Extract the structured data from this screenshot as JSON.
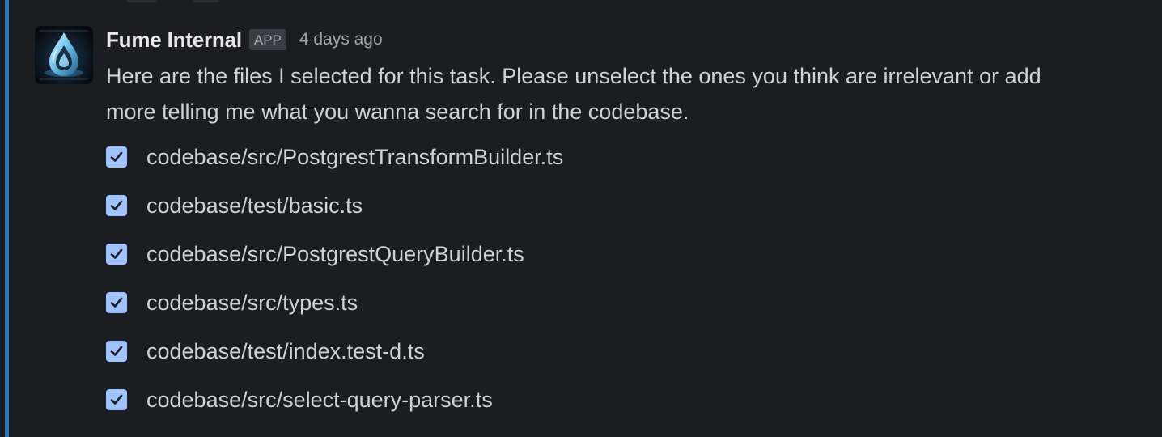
{
  "message": {
    "sender": "Fume Internal",
    "badge": "APP",
    "timestamp": "4 days ago",
    "body": "Here are the files I selected for this task. Please unselect the ones you think are irrelevant or add more telling me what you wanna search for in the codebase."
  },
  "files": [
    {
      "path": "codebase/src/PostgrestTransformBuilder.ts",
      "checked": true
    },
    {
      "path": "codebase/test/basic.ts",
      "checked": true
    },
    {
      "path": "codebase/src/PostgrestQueryBuilder.ts",
      "checked": true
    },
    {
      "path": "codebase/src/types.ts",
      "checked": true
    },
    {
      "path": "codebase/test/index.test-d.ts",
      "checked": true
    },
    {
      "path": "codebase/src/select-query-parser.ts",
      "checked": true
    }
  ],
  "colors": {
    "background": "#1b1d21",
    "thread_accent": "#2f74b5",
    "checkbox": "#9fc3ff",
    "checkmark": "#1b1d21"
  },
  "icons": {
    "avatar": "water-drop-logo-icon",
    "checkbox": "check-icon"
  }
}
